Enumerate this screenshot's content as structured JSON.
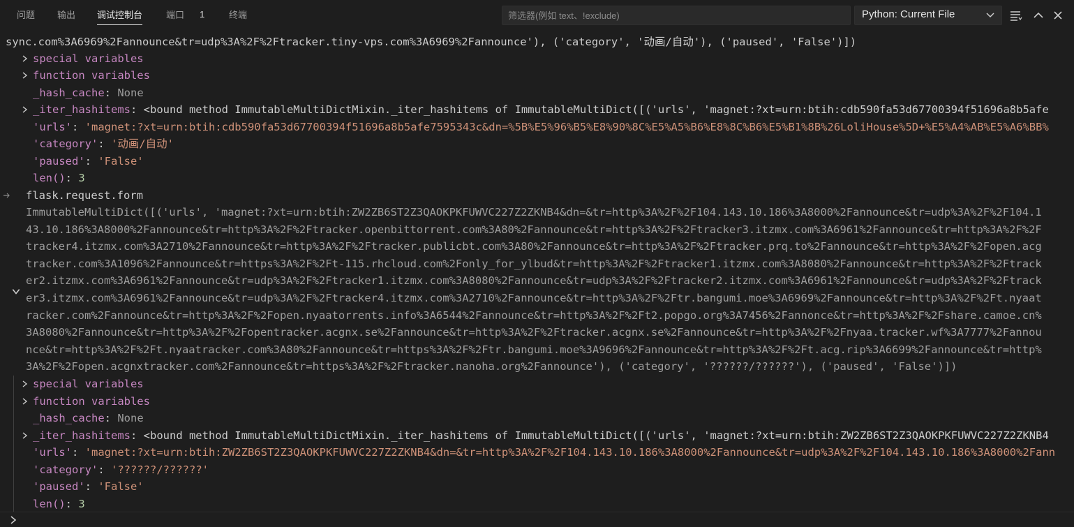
{
  "tabs": [
    {
      "label": "问题",
      "active": false
    },
    {
      "label": "输出",
      "active": false
    },
    {
      "label": "调试控制台",
      "active": true
    },
    {
      "label": "端口",
      "active": false,
      "badge": "1"
    },
    {
      "label": "终端",
      "active": false
    }
  ],
  "filter": {
    "placeholder": "筛选器(例如 text、!exclude)",
    "value": ""
  },
  "launch_config": {
    "selected": "Python: Current File"
  },
  "header_icons": [
    "collapse-all-icon",
    "maximize-panel-icon",
    "close-panel-icon"
  ],
  "console": {
    "block1": {
      "tail_line": "sync.com%3A6969%2Fannounce&tr=udp%3A%2F%2Ftracker.tiny-vps.com%3A6969%2Fannounce'), ('category', '动画/自动'), ('paused', 'False')])",
      "special_variables": "special variables",
      "function_variables": "function variables",
      "hash_cache_key": "_hash_cache",
      "hash_cache_value": "None",
      "iter_key": "_iter_hashitems",
      "iter_value": "<bound method ImmutableMultiDictMixin._iter_hashitems of ImmutableMultiDict([('urls', 'magnet:?xt=urn:btih:cdb590fa53d67700394f51696a8b5afe",
      "urls_key": "'urls'",
      "urls_value": "'magnet:?xt=urn:btih:cdb590fa53d67700394f51696a8b5afe7595343c&dn=%5B%E5%96%B5%E8%90%8C%E5%A5%B6%E8%8C%B6%E5%B1%8B%26LoliHouse%5D+%E5%A4%AB%E5%A6%BB%",
      "category_key": "'category'",
      "category_value": "'动画/自动'",
      "paused_key": "'paused'",
      "paused_value": "'False'",
      "len_key": "len()",
      "len_value": "3"
    },
    "expression": "flask.request.form",
    "result_lines": [
      "ImmutableMultiDict([('urls', 'magnet:?xt=urn:btih:ZW2ZB6ST2Z3QAOKPKFUWVC227Z2ZKNB4&dn=&tr=http%3A%2F%2F104.143.10.186%3A8000%2Fannounce&tr=udp%3A%2F%2F104.1",
      "43.10.186%3A8000%2Fannounce&tr=http%3A%2F%2Ftracker.openbittorrent.com%3A80%2Fannounce&tr=http%3A%2F%2Ftracker3.itzmx.com%3A6961%2Fannounce&tr=http%3A%2F%2F",
      "tracker4.itzmx.com%3A2710%2Fannounce&tr=http%3A%2F%2Ftracker.publicbt.com%3A80%2Fannounce&tr=http%3A%2F%2Ftracker.prq.to%2Fannounce&tr=http%3A%2F%2Fopen.acg",
      "tracker.com%3A1096%2Fannounce&tr=https%3A%2F%2Ft-115.rhcloud.com%2Fonly_for_ylbud&tr=http%3A%2F%2Ftracker1.itzmx.com%3A8080%2Fannounce&tr=http%3A%2F%2Ftrack",
      "er2.itzmx.com%3A6961%2Fannounce&tr=udp%3A%2F%2Ftracker1.itzmx.com%3A8080%2Fannounce&tr=udp%3A%2F%2Ftracker2.itzmx.com%3A6961%2Fannounce&tr=udp%3A%2F%2Ftrack",
      "er3.itzmx.com%3A6961%2Fannounce&tr=udp%3A%2F%2Ftracker4.itzmx.com%3A2710%2Fannounce&tr=http%3A%2F%2Ftr.bangumi.moe%3A6969%2Fannounce&tr=http%3A%2F%2Ft.nyaat",
      "racker.com%2Fannounce&tr=http%3A%2F%2Fopen.nyaatorrents.info%3A6544%2Fannounce&tr=http%3A%2F%2Ft2.popgo.org%3A7456%2Fannonce&tr=http%3A%2F%2Fshare.camoe.cn%",
      "3A8080%2Fannounce&tr=http%3A%2F%2Fopentracker.acgnx.se%2Fannounce&tr=http%3A%2F%2Ftracker.acgnx.se%2Fannounce&tr=http%3A%2F%2Fnyaa.tracker.wf%3A7777%2Fannou",
      "nce&tr=http%3A%2F%2Ft.nyaatracker.com%3A80%2Fannounce&tr=https%3A%2F%2Ftr.bangumi.moe%3A9696%2Fannounce&tr=http%3A%2F%2Ft.acg.rip%3A6699%2Fannounce&tr=http%",
      "3A%2F%2Fopen.acgnxtracker.com%2Fannounce&tr=https%3A%2F%2Ftracker.nanoha.org%2Fannounce'), ('category', '??????/??????'), ('paused', 'False')])"
    ],
    "block2": {
      "special_variables": "special variables",
      "function_variables": "function variables",
      "hash_cache_key": "_hash_cache",
      "hash_cache_value": "None",
      "iter_key": "_iter_hashitems",
      "iter_value": "<bound method ImmutableMultiDictMixin._iter_hashitems of ImmutableMultiDict([('urls', 'magnet:?xt=urn:btih:ZW2ZB6ST2Z3QAOKPKFUWVC227Z2ZKNB4",
      "urls_key": "'urls'",
      "urls_value": "'magnet:?xt=urn:btih:ZW2ZB6ST2Z3QAOKPKFUWVC227Z2ZKNB4&dn=&tr=http%3A%2F%2F104.143.10.186%3A8000%2Fannounce&tr=udp%3A%2F%2F104.143.10.186%3A8000%2Fann",
      "category_key": "'category'",
      "category_value": "'??????/??????'",
      "paused_key": "'paused'",
      "paused_value": "'False'",
      "len_key": "len()",
      "len_value": "3"
    }
  },
  "repl": {
    "value": ""
  }
}
